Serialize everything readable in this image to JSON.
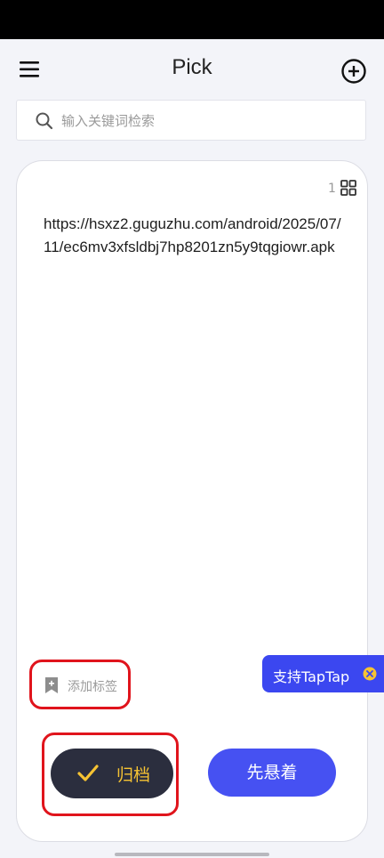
{
  "header": {
    "title": "Pick",
    "menu_icon": "hamburger-menu-icon",
    "add_icon": "plus-circle-icon"
  },
  "search": {
    "placeholder": "输入关键词检索",
    "value": "",
    "icon": "search-icon"
  },
  "card": {
    "page_count": "1",
    "grid_icon": "grid-view-icon",
    "content": "https://hsxz2.guguzhu.com/android/2025/07/11/ec6mv3xfsldbj7hp8201zn5y9tqgiowr.apk",
    "tag_label": "添加标签",
    "tag_icon": "bookmark-plus-icon",
    "archive_label": "归档",
    "archive_icon": "check-icon",
    "later_label": "先悬着"
  },
  "banner": {
    "label": "支持TapTap",
    "close_icon": "close-icon"
  },
  "colors": {
    "background": "#f3f4f9",
    "archive_button": "#2b2e3e",
    "archive_text": "#f6c333",
    "later_button": "#4651f2",
    "taptap_banner": "#3b47f0",
    "highlight": "#e0141c"
  }
}
